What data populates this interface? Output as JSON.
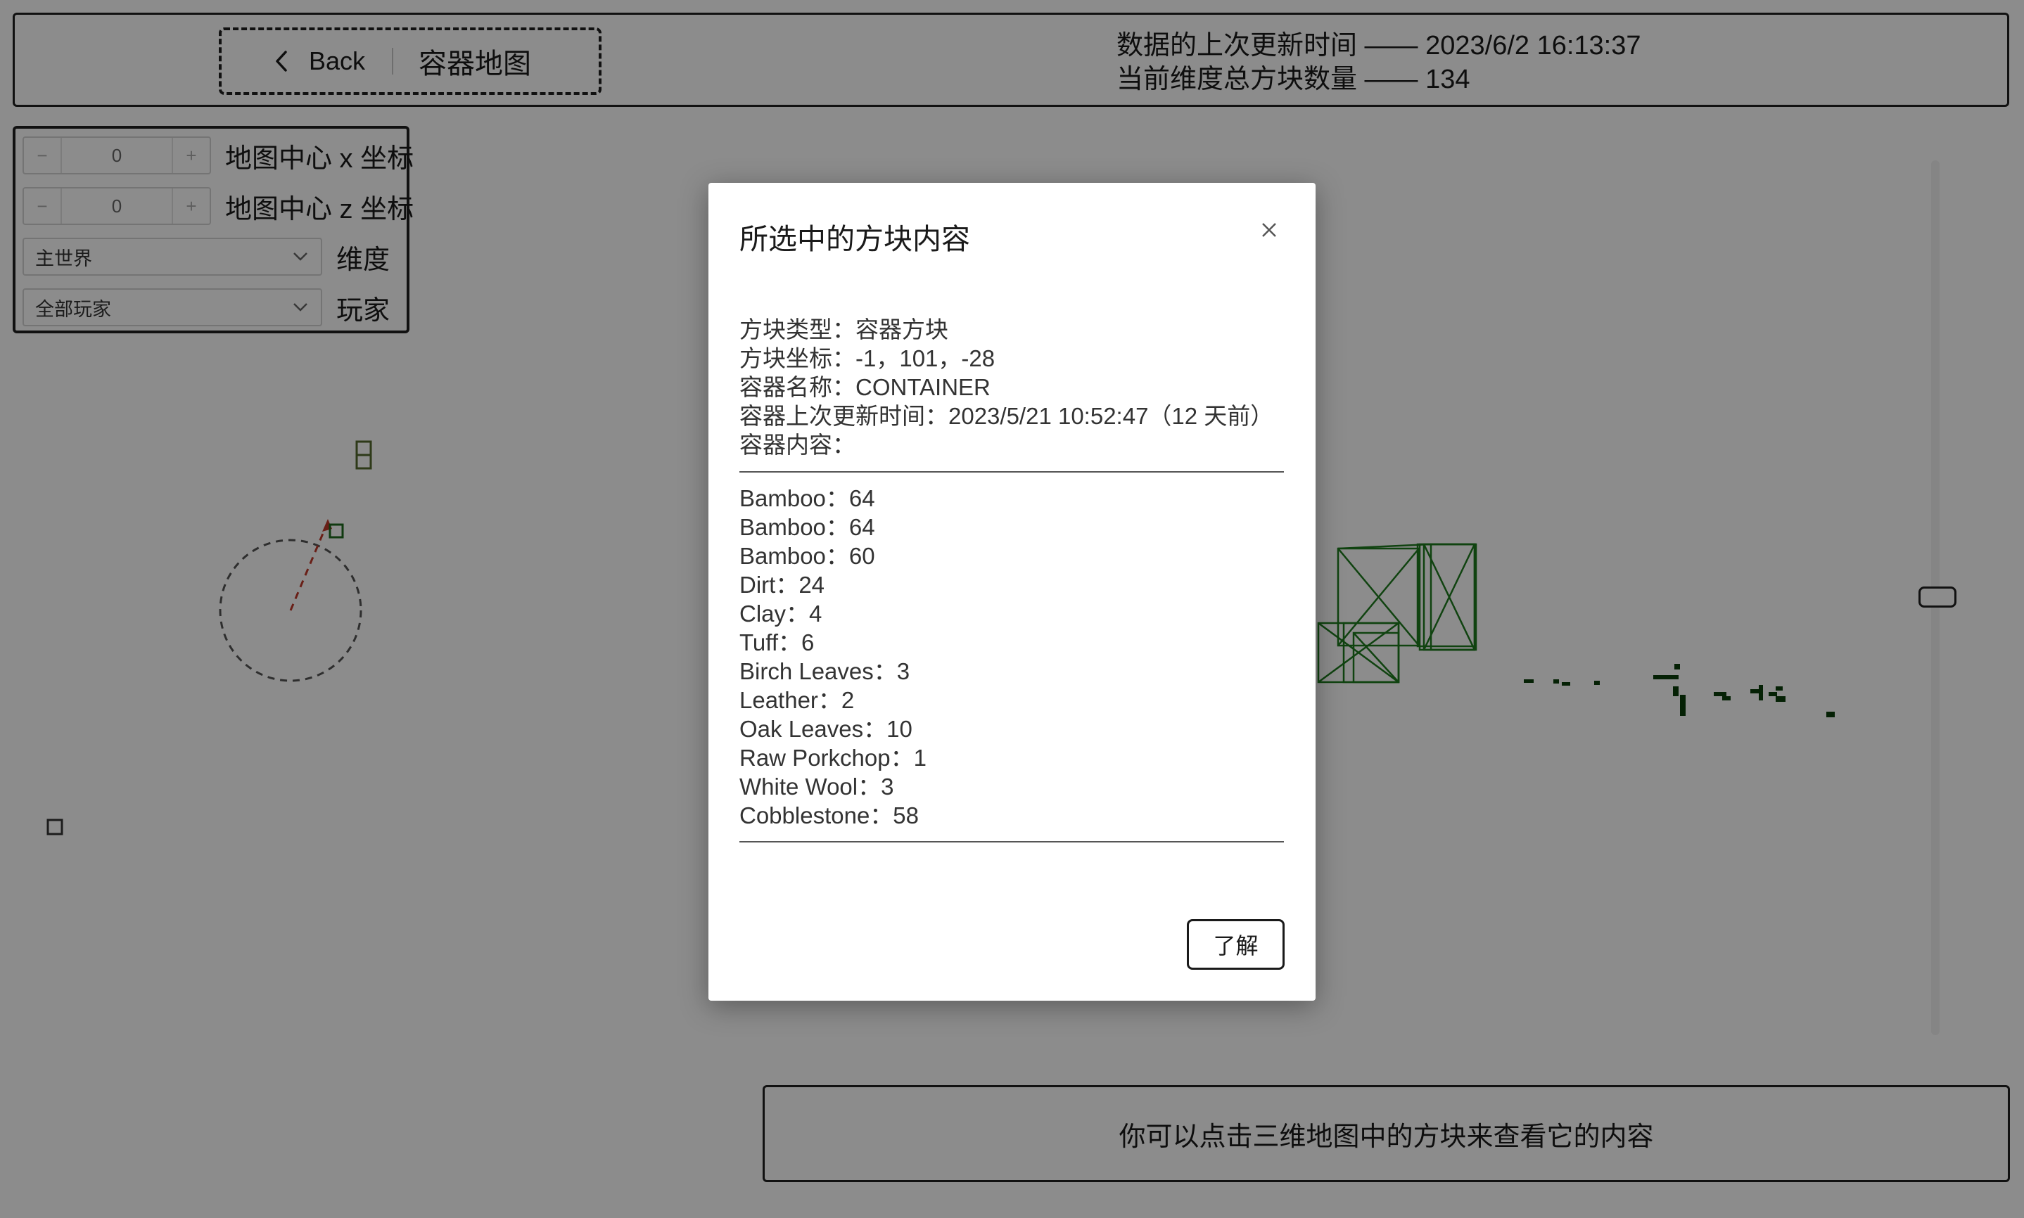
{
  "header": {
    "back_label": "Back",
    "title": "容器地图",
    "update_line": "数据的上次更新时间 —— 2023/6/2 16:13:37",
    "count_line": "当前维度总方块数量 —— 134"
  },
  "controls": {
    "x_center": {
      "value": "0",
      "minus": "−",
      "plus": "+",
      "label": "地图中心 x 坐标"
    },
    "z_center": {
      "value": "0",
      "minus": "−",
      "plus": "+",
      "label": "地图中心 z 坐标"
    },
    "dimension": {
      "value": "主世界",
      "label": "维度"
    },
    "player": {
      "value": "全部玩家",
      "label": "玩家"
    }
  },
  "hint": "你可以点击三维地图中的方块来查看它的内容",
  "modal": {
    "title": "所选中的方块内容",
    "info": [
      "方块类型：容器方块",
      "方块坐标：-1，101，-28",
      "容器名称：CONTAINER",
      "容器上次更新时间：2023/5/21 10:52:47（12 天前）",
      "容器内容："
    ],
    "items": [
      "Bamboo：64",
      "Bamboo：64",
      "Bamboo：60",
      "Dirt：24",
      "Clay：4",
      "Tuff：6",
      "Birch Leaves：3",
      "Leather：2",
      "Oak Leaves：10",
      "Raw Porkchop：1",
      "White Wool：3",
      "Cobblestone：58"
    ],
    "ok_label": "了解"
  },
  "icons": {
    "back": "chevron-left-icon",
    "close": "close-icon",
    "dropdown": "chevron-down-icon"
  },
  "colors": {
    "block_outline": "#1e6b1e",
    "block_fill": "#0a3d0a",
    "direction_arrow": "#c0392b"
  }
}
